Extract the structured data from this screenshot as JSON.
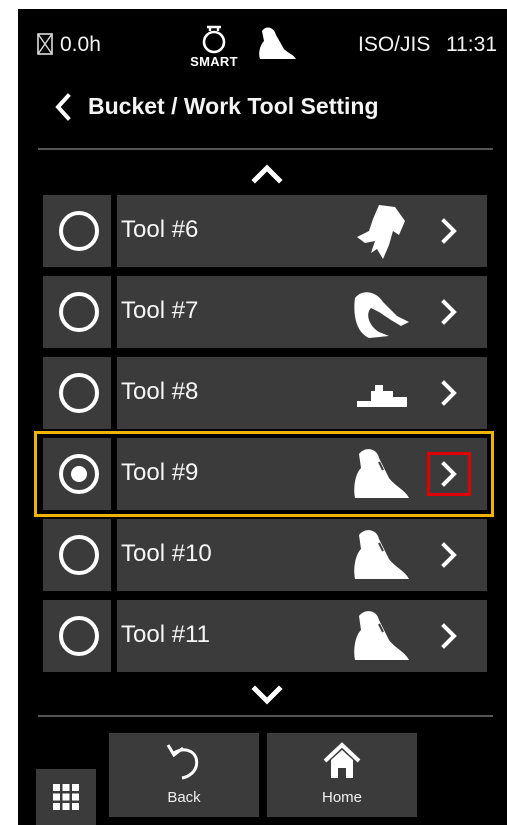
{
  "status": {
    "hours": "0.0h",
    "mode_label": "SMART",
    "standard": "ISO/JIS",
    "time": "11:31"
  },
  "header": {
    "title": "Bucket / Work Tool Setting"
  },
  "tools": [
    {
      "label": "Tool #6",
      "selected": false,
      "icon": "grapple-tool-icon"
    },
    {
      "label": "Tool #7",
      "selected": false,
      "icon": "clamshell-tool-icon"
    },
    {
      "label": "Tool #8",
      "selected": false,
      "icon": "plate-compactor-icon"
    },
    {
      "label": "Tool #9",
      "selected": true,
      "icon": "bucket-icon"
    },
    {
      "label": "Tool #10",
      "selected": false,
      "icon": "bucket-icon"
    },
    {
      "label": "Tool #11",
      "selected": false,
      "icon": "bucket-icon"
    }
  ],
  "footer": {
    "back_label": "Back",
    "home_label": "Home"
  },
  "colors": {
    "background": "#000000",
    "cell": "#3b3b3b",
    "selected_outline": "#f0b400",
    "highlight_box": "#e00000"
  }
}
